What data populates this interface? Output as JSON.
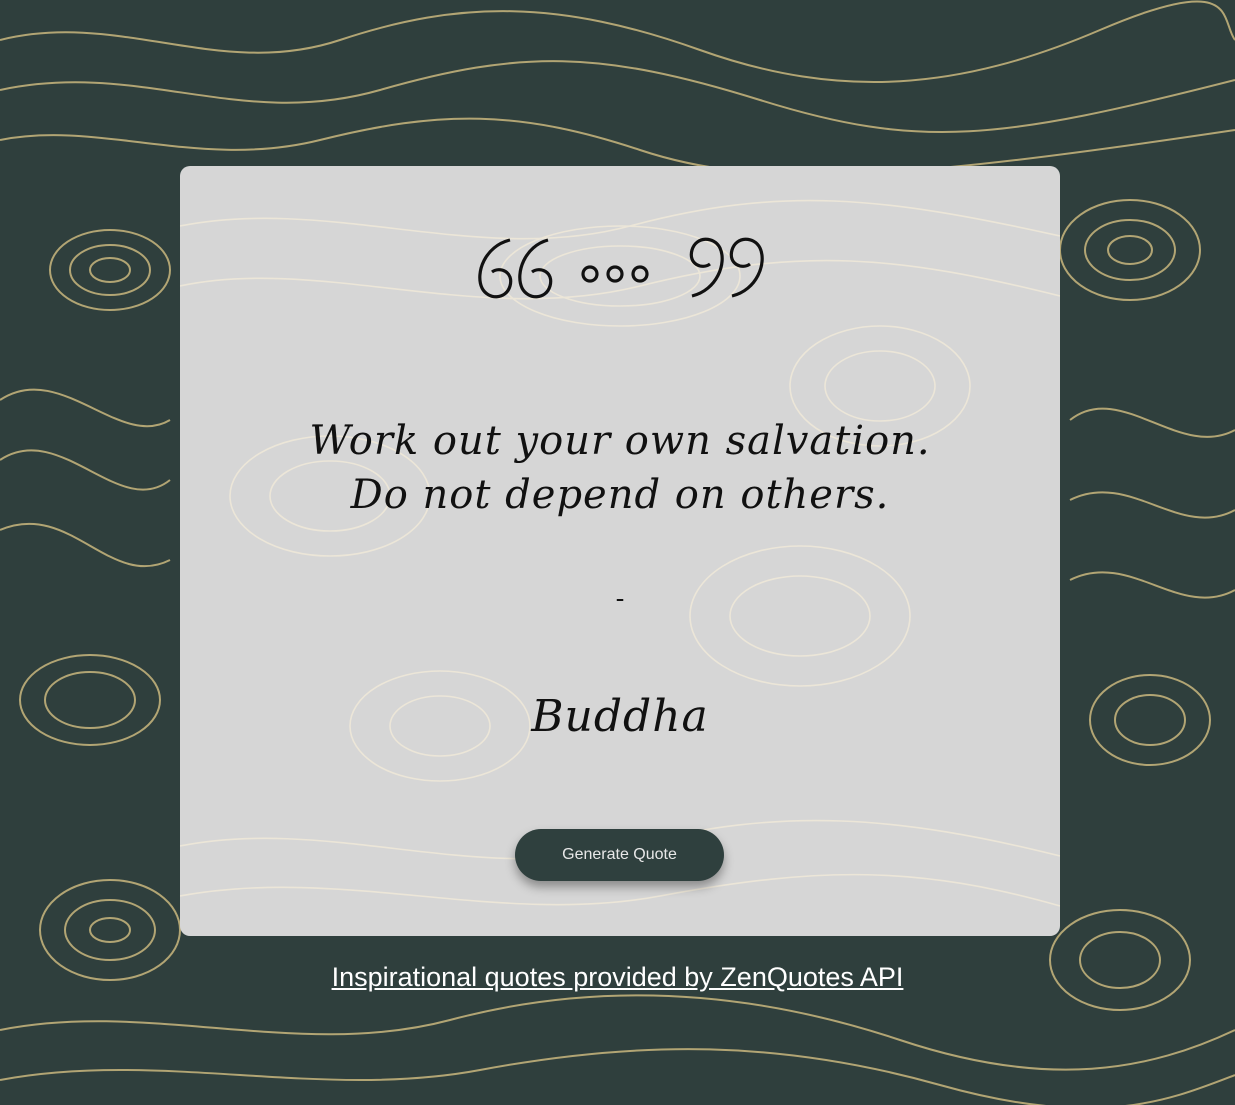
{
  "colors": {
    "background": "#2f3f3d",
    "contour_lines_outer": "#c9b77e",
    "card_background": "#d6d6d6",
    "contour_lines_card": "#ece6d8",
    "button_background": "#2f403e",
    "text": "#111111",
    "link": "#ffffff"
  },
  "icons": {
    "quote": "quote-ellipsis-icon"
  },
  "quote": {
    "text_line_1": "Work out your own salvation.",
    "text_line_2": "Do not depend on others.",
    "separator": "-",
    "author": "Buddha"
  },
  "button": {
    "label": "Generate Quote"
  },
  "footer": {
    "link_text": "Inspirational quotes provided by ZenQuotes API"
  }
}
